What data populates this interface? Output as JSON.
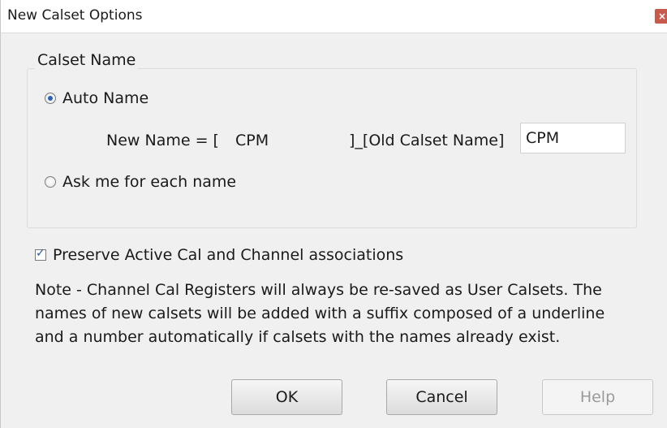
{
  "window": {
    "title": "New Calset Options",
    "close_icon": "×"
  },
  "calset_name": {
    "group_label": "Calset Name",
    "auto_name": {
      "label": "Auto Name",
      "checked": true
    },
    "formula": {
      "prefix": "New Name = [",
      "value": "CPM",
      "suffix": "]_[Old Calset Name]"
    },
    "prefix_input": {
      "value": "CPM"
    },
    "ask_name": {
      "label": "Ask me for each name",
      "checked": false
    }
  },
  "preserve": {
    "label": "Preserve Active Cal and Channel associations",
    "checked": true
  },
  "note": {
    "line1": "Note - Channel Cal Registers will always be re-saved as User Calsets. The",
    "line2": "names of new calsets will be added with a suffix composed of a underline",
    "line3": "and a number automatically if calsets with the names already exist."
  },
  "buttons": {
    "ok": "OK",
    "cancel": "Cancel",
    "help": "Help"
  }
}
